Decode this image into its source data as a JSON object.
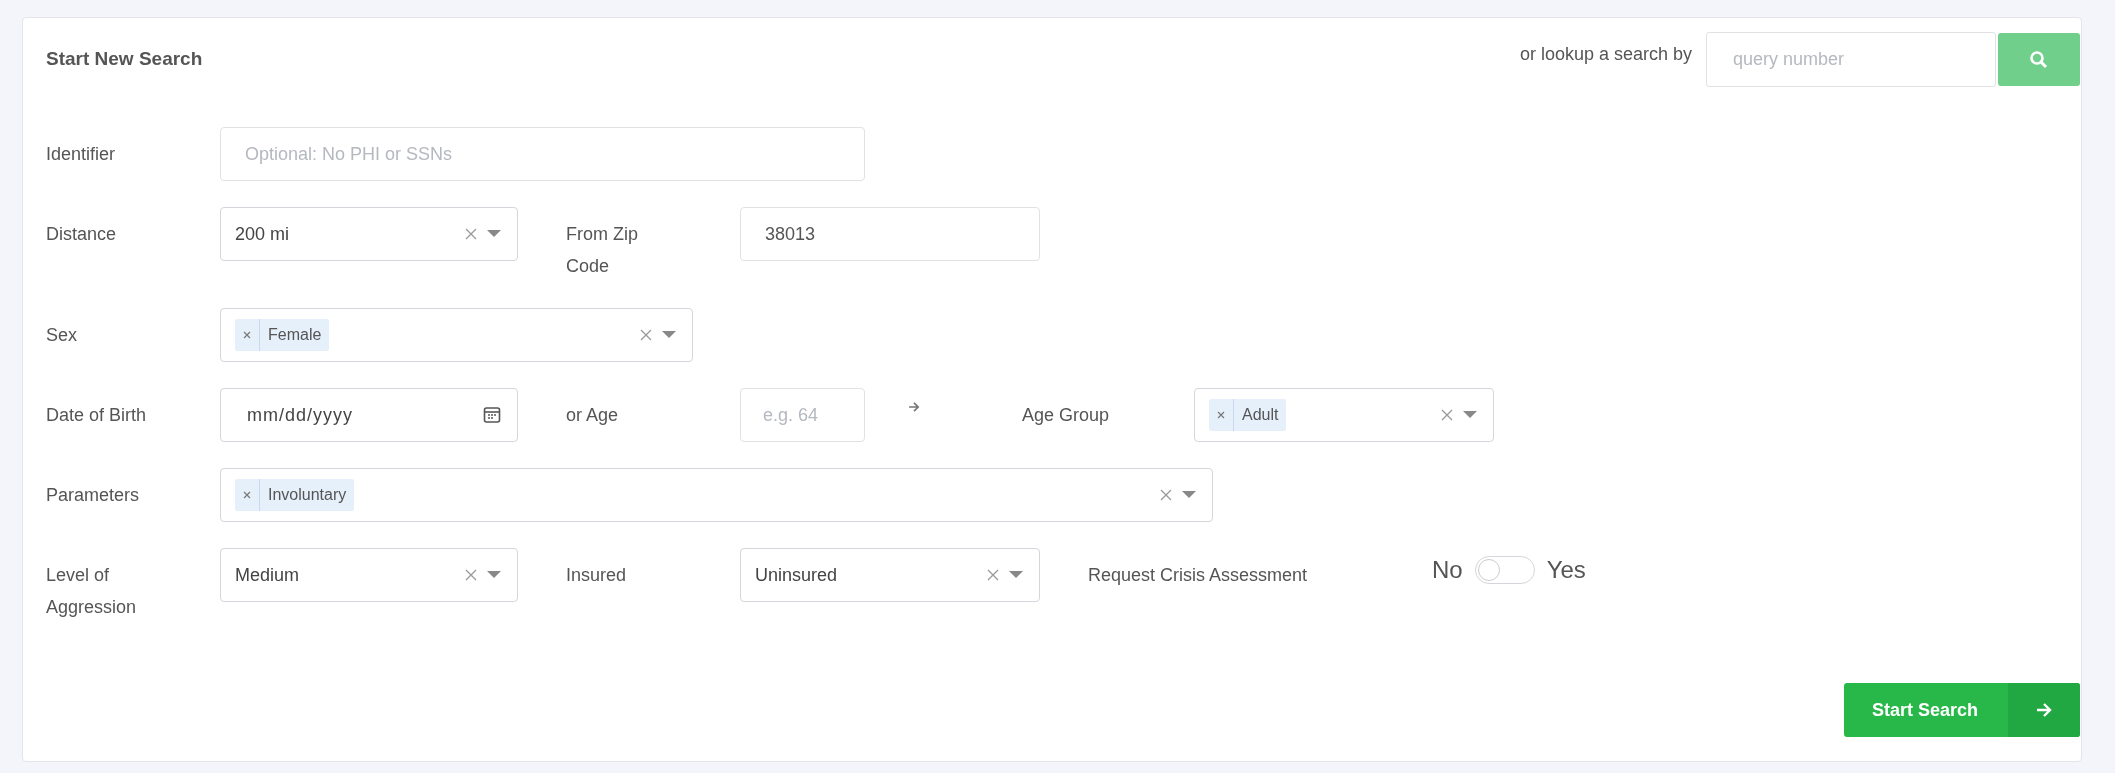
{
  "title": "Start New Search",
  "lookup": {
    "label": "or lookup a search by",
    "placeholder": "query number"
  },
  "identifier": {
    "label": "Identifier",
    "placeholder": "Optional: No PHI or SSNs"
  },
  "distance": {
    "label": "Distance",
    "value": "200 mi"
  },
  "zip": {
    "label": "From Zip Code",
    "value": "38013"
  },
  "sex": {
    "label": "Sex",
    "tags": [
      "Female"
    ]
  },
  "dob": {
    "label": "Date of Birth",
    "placeholder": "mm/dd/yyyy"
  },
  "age": {
    "label": "or Age",
    "placeholder": "e.g. 64"
  },
  "age_group": {
    "label": "Age Group",
    "tags": [
      "Adult"
    ]
  },
  "parameters": {
    "label": "Parameters",
    "tags": [
      "Involuntary"
    ]
  },
  "aggression": {
    "label": "Level of Aggression",
    "value": "Medium"
  },
  "insured": {
    "label": "Insured",
    "value": "Uninsured"
  },
  "crisis": {
    "label": "Request Crisis Assessment",
    "off_label": "No",
    "on_label": "Yes",
    "on": false
  },
  "submit": {
    "label": "Start Search"
  }
}
